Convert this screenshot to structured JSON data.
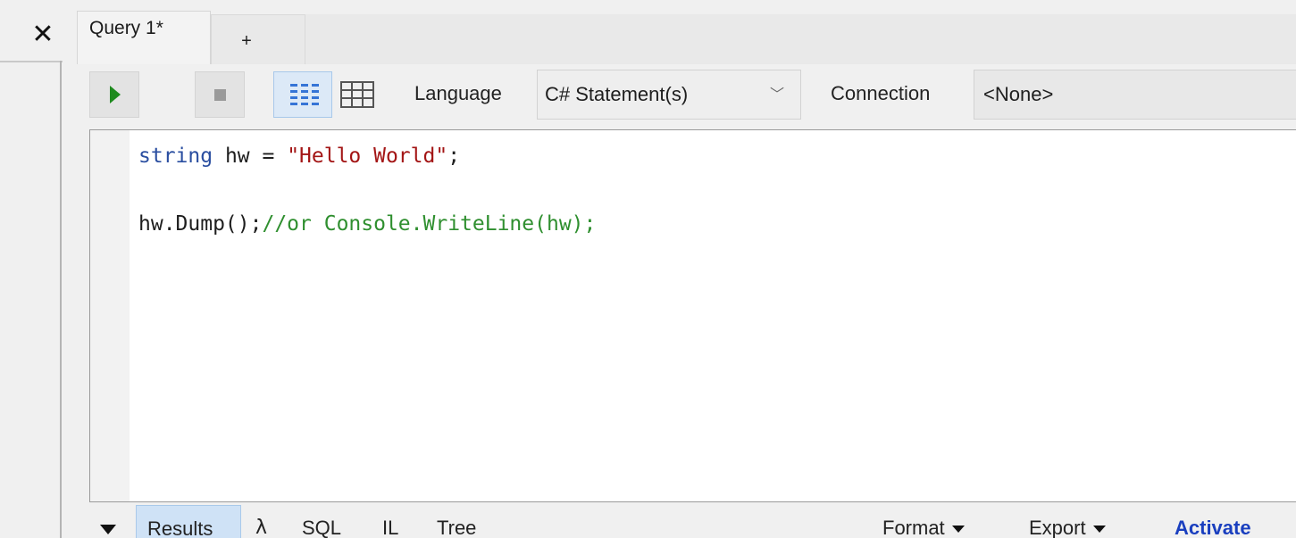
{
  "window": {
    "close_glyph": "✕"
  },
  "tabs": {
    "query_label": "Query 1*",
    "add_label": "+"
  },
  "toolbar": {
    "run_icon": "play-icon",
    "stop_icon": "stop-icon",
    "language_label": "Language",
    "language_value": "C# Statement(s)",
    "connection_label": "Connection",
    "connection_value": "<None>"
  },
  "editor": {
    "lines": [
      [
        {
          "text": "string",
          "style": "kw"
        },
        {
          "text": " hw = ",
          "style": "plain"
        },
        {
          "text": "\"Hello World\"",
          "style": "str"
        },
        {
          "text": ";",
          "style": "plain"
        }
      ],
      [],
      [
        {
          "text": "hw.Dump();",
          "style": "plain"
        },
        {
          "text": "//or Console.WriteLine(hw);",
          "style": "cmt"
        }
      ]
    ]
  },
  "results_bar": {
    "tabs": [
      "Results",
      "λ",
      "SQL",
      "IL",
      "Tree"
    ],
    "format_label": "Format",
    "export_label": "Export",
    "activate_label": "Activate"
  },
  "colors": {
    "keyword": "#2a4ea0",
    "string": "#a31515",
    "comment": "#2f8f2f",
    "run_green": "#1e8a1e",
    "activate_blue": "#1a3fbf"
  }
}
